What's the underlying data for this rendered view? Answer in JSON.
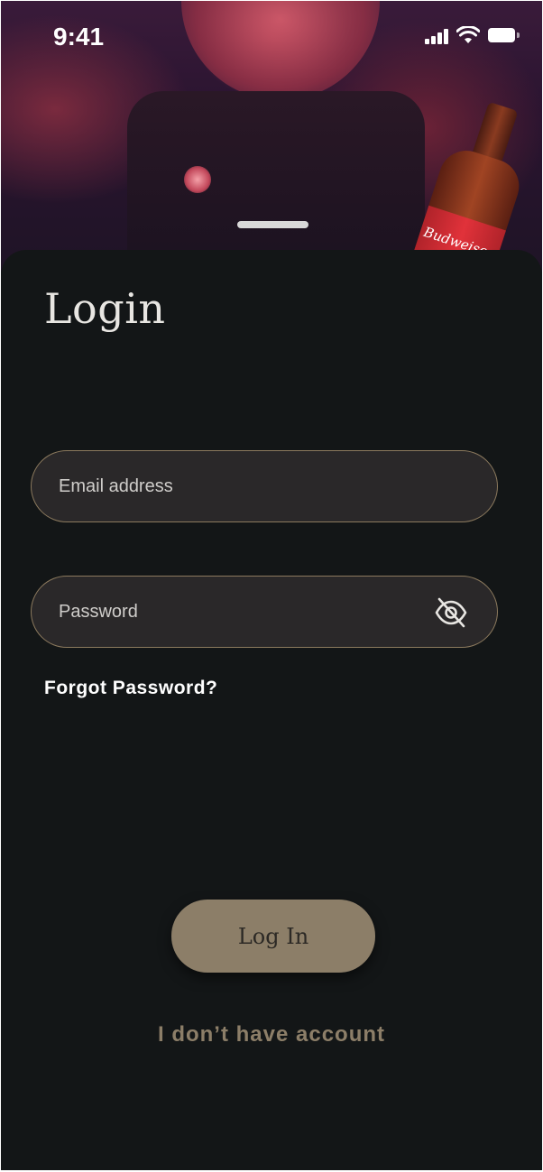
{
  "status_bar": {
    "time": "9:41"
  },
  "hero": {
    "bottle_label": "Budweiser"
  },
  "sheet": {
    "title": "Login",
    "email_field": {
      "placeholder": "Email address",
      "value": ""
    },
    "password_field": {
      "placeholder": "Password",
      "value": "",
      "toggle_icon": "eye-off-icon"
    },
    "forgot_password_label": "Forgot Password?",
    "login_button_label": "Log In",
    "no_account_label": "I don’t have account"
  },
  "colors": {
    "background": "#131617",
    "field_background": "#2a2829",
    "field_border": "#8c7a5e",
    "accent": "#8c7e68",
    "text_primary": "#ffffff"
  }
}
